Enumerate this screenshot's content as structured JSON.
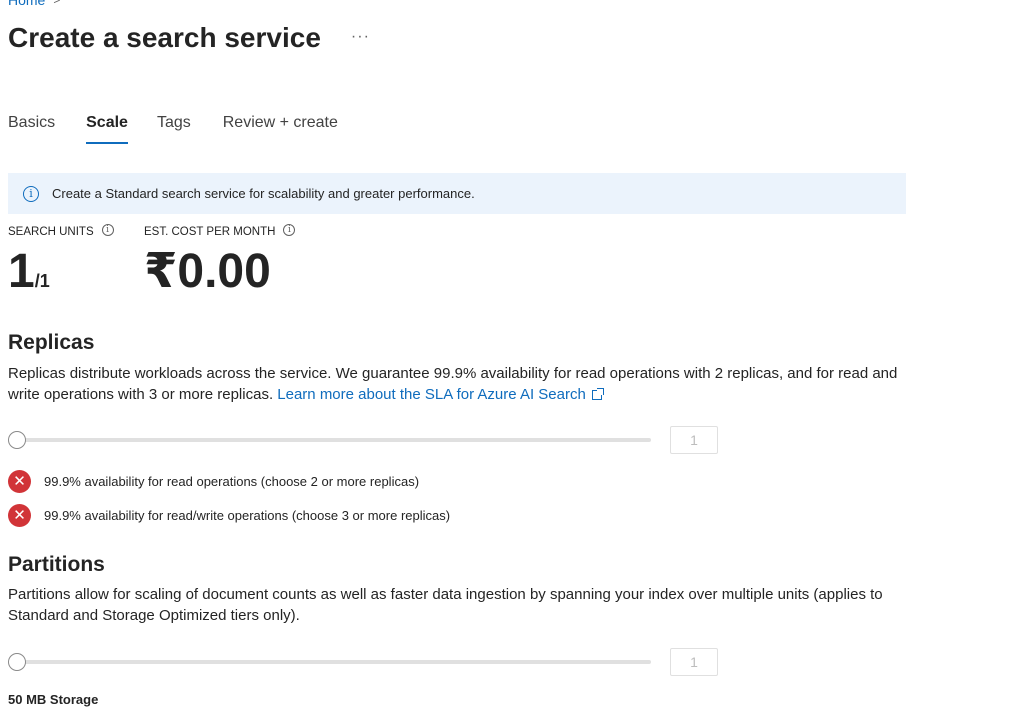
{
  "breadcrumb": {
    "home": "Home",
    "separator": ">"
  },
  "header": {
    "title": "Create a search service",
    "more": "···"
  },
  "tabs": [
    {
      "label": "Basics"
    },
    {
      "label": "Scale"
    },
    {
      "label": "Tags"
    },
    {
      "label": "Review + create"
    }
  ],
  "active_tab": "Scale",
  "info_bar": {
    "icon": "info-icon",
    "text": "Create a Standard search service for scalability and greater performance."
  },
  "metrics": {
    "search_units": {
      "label": "SEARCH UNITS",
      "value": "1",
      "sub": "/1"
    },
    "cost": {
      "label": "EST. COST PER MONTH",
      "value": "₹0.00"
    }
  },
  "replicas": {
    "title": "Replicas",
    "description": "Replicas distribute workloads across the service. We guarantee 99.9% availability for read operations with 2 replicas, and for read and write operations with 3 or more replicas.",
    "link_text": "Learn more about the SLA for Azure AI Search",
    "slider_value": "1",
    "slider_level": 0,
    "checks": [
      {
        "text": "99.9% availability for read operations (choose 2 or more replicas)",
        "status": "error"
      },
      {
        "text": "99.9% availability for read/write operations (choose 3 or more replicas)",
        "status": "error"
      }
    ]
  },
  "partitions": {
    "title": "Partitions",
    "description": "Partitions allow for scaling of document counts as well as faster data ingestion by spanning your index over multiple units (applies to Standard and Storage Optimized tiers only).",
    "slider_value": "1",
    "slider_level": 0,
    "storage": "50 MB Storage"
  },
  "colors": {
    "accent": "#0f6cbd",
    "error": "#d13438",
    "info_bg": "#ebf3fc"
  }
}
